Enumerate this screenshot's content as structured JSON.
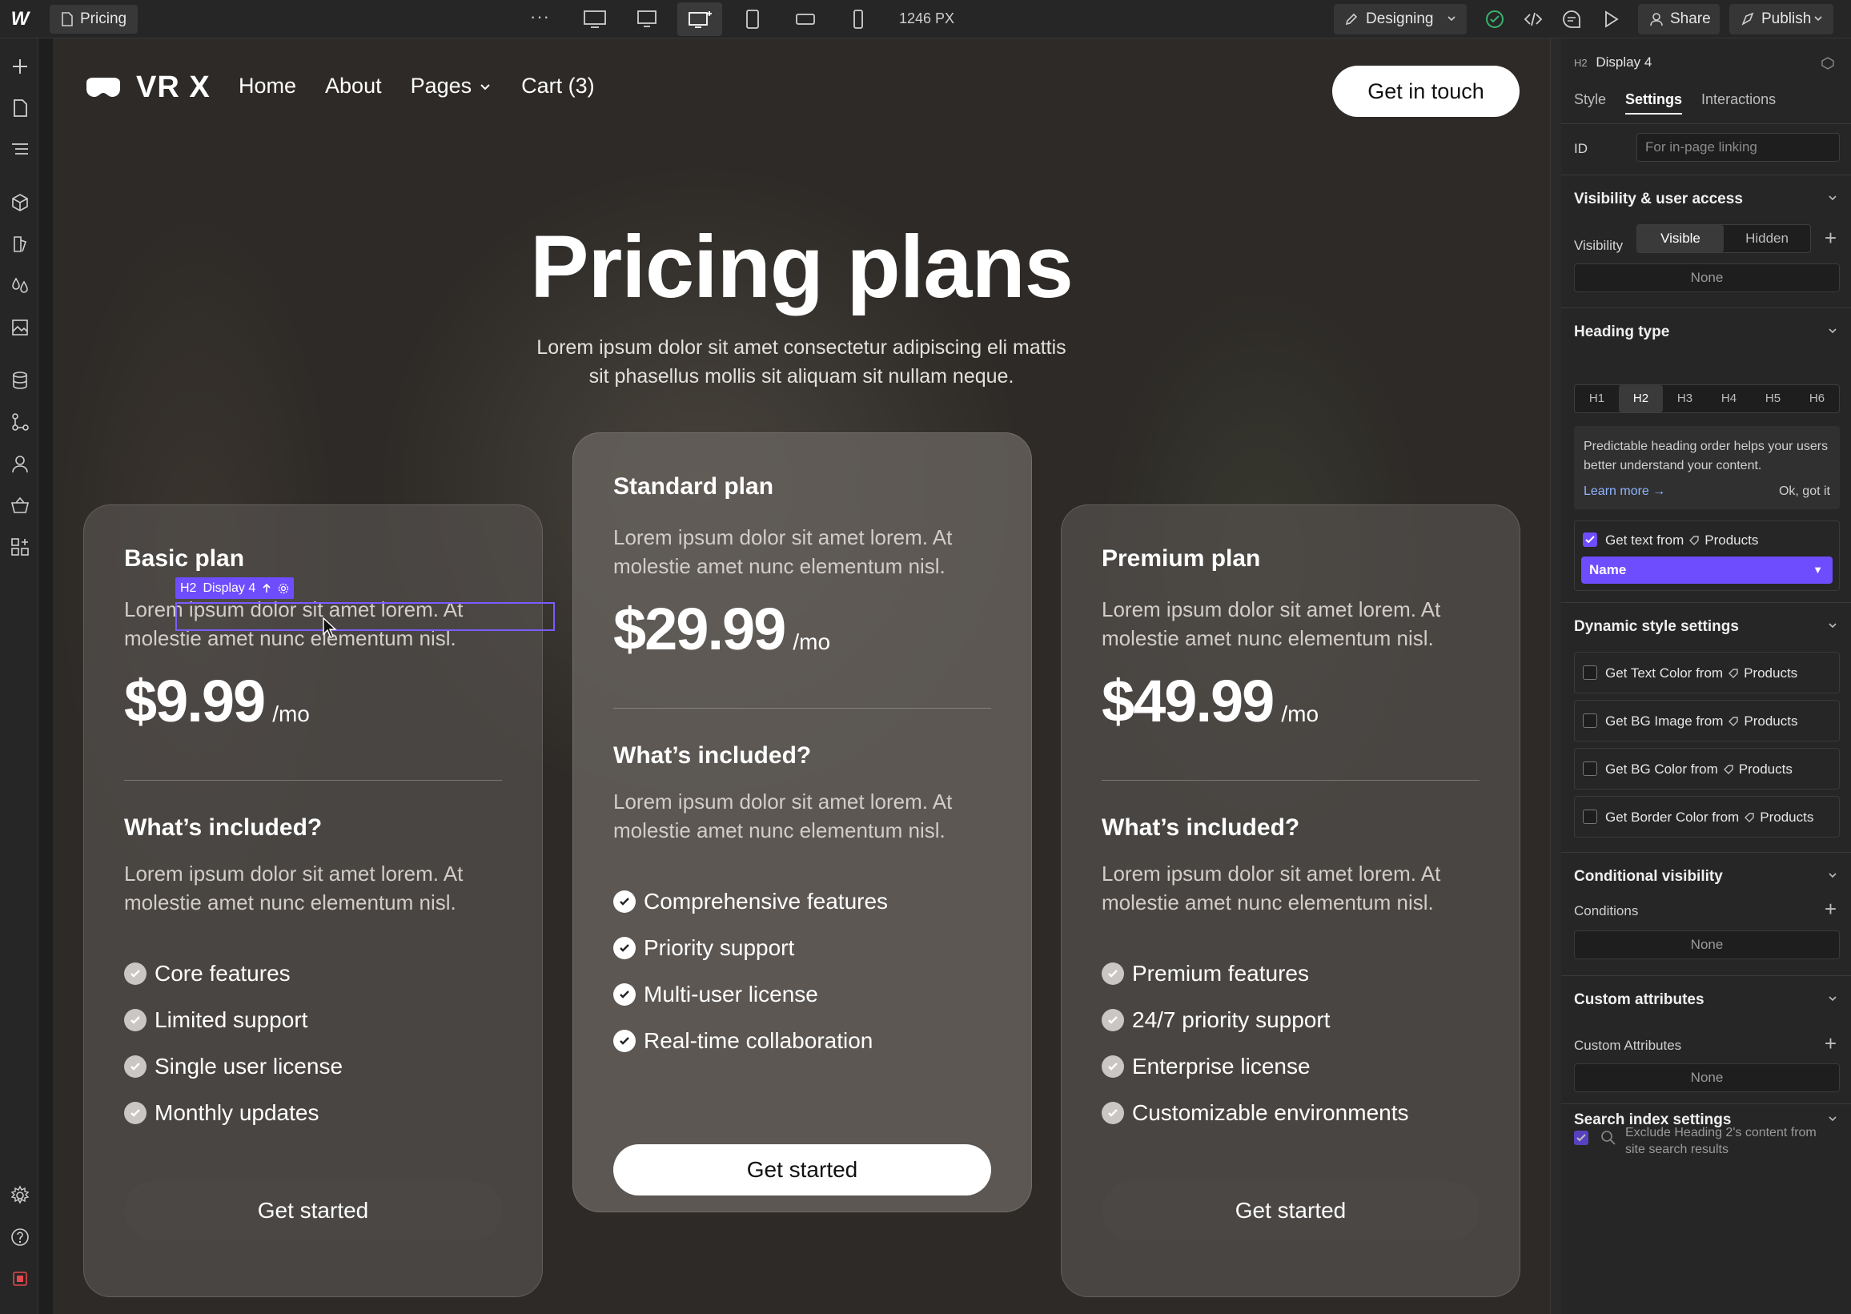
{
  "topbar": {
    "logo": "W",
    "page_name": "Pricing",
    "more": "···",
    "width_readout": "1246 PX",
    "mode": "Designing",
    "share": "Share",
    "publish": "Publish"
  },
  "site": {
    "logo_text": "VR X",
    "nav": {
      "home": "Home",
      "about": "About",
      "pages": "Pages",
      "cart": "Cart (3)"
    },
    "cta": "Get in touch",
    "hero_title": "Pricing plans",
    "hero_sub": "Lorem ipsum dolor sit amet consectetur adipiscing eli mattis sit phasellus mollis sit aliquam sit nullam neque.",
    "plans": [
      {
        "name": "Basic plan",
        "desc": "Lorem ipsum dolor sit amet lorem. At molestie amet nunc elementum nisl.",
        "price": "$9.99",
        "per": "/mo",
        "included_title": "What’s included?",
        "included_desc": "Lorem ipsum dolor sit amet lorem. At molestie amet nunc elementum nisl.",
        "features": [
          "Core features",
          "Limited support",
          "Single user license",
          "Monthly updates"
        ],
        "cta": "Get started"
      },
      {
        "name": "Standard plan",
        "desc": "Lorem ipsum dolor sit amet lorem. At molestie amet nunc elementum nisl.",
        "price": "$29.99",
        "per": "/mo",
        "included_title": "What’s included?",
        "included_desc": "Lorem ipsum dolor sit amet lorem. At molestie amet nunc elementum nisl.",
        "features": [
          "Comprehensive features",
          "Priority support",
          "Multi-user license",
          "Real-time collaboration"
        ],
        "cta": "Get started"
      },
      {
        "name": "Premium plan",
        "desc": "Lorem ipsum dolor sit amet lorem. At molestie amet nunc elementum nisl.",
        "price": "$49.99",
        "per": "/mo",
        "included_title": "What’s included?",
        "included_desc": "Lorem ipsum dolor sit amet lorem. At molestie amet nunc elementum nisl.",
        "features": [
          "Premium features",
          "24/7 priority support",
          "Enterprise license",
          "Customizable environments"
        ],
        "cta": "Get started"
      }
    ]
  },
  "selection": {
    "tag": "H2",
    "label": "Display 4"
  },
  "panel": {
    "element_tag": "H2",
    "element_name": "Display 4",
    "tabs": {
      "style": "Style",
      "settings": "Settings",
      "interactions": "Interactions"
    },
    "id_label": "ID",
    "id_placeholder": "For in-page linking",
    "visibility": {
      "title": "Visibility & user access",
      "label": "Visibility",
      "visible": "Visible",
      "hidden": "Hidden",
      "none": "None"
    },
    "heading_type": {
      "title": "Heading type",
      "options": [
        "H1",
        "H2",
        "H3",
        "H4",
        "H5",
        "H6"
      ],
      "selected": "H2",
      "note": "Predictable heading order helps your users better understand your content.",
      "learn_more": "Learn more →",
      "ok": "Ok, got it"
    },
    "get_text": {
      "label": "Get text from",
      "source": "Products",
      "field": "Name"
    },
    "dynamic": {
      "title": "Dynamic style settings",
      "rows": [
        {
          "label": "Get Text Color from",
          "source": "Products"
        },
        {
          "label": "Get BG Image from",
          "source": "Products"
        },
        {
          "label": "Get BG Color from",
          "source": "Products"
        },
        {
          "label": "Get Border Color from",
          "source": "Products"
        }
      ]
    },
    "conditional": {
      "title": "Conditional visibility",
      "label": "Conditions",
      "none": "None"
    },
    "custom_attrs": {
      "title": "Custom attributes",
      "label": "Custom Attributes",
      "none": "None"
    },
    "search": {
      "title": "Search index settings",
      "text": "Exclude Heading 2's content from site search results"
    }
  },
  "colors": {
    "accent": "#6e4dff",
    "canvas": "#2d2a27",
    "panel": "#262626"
  }
}
